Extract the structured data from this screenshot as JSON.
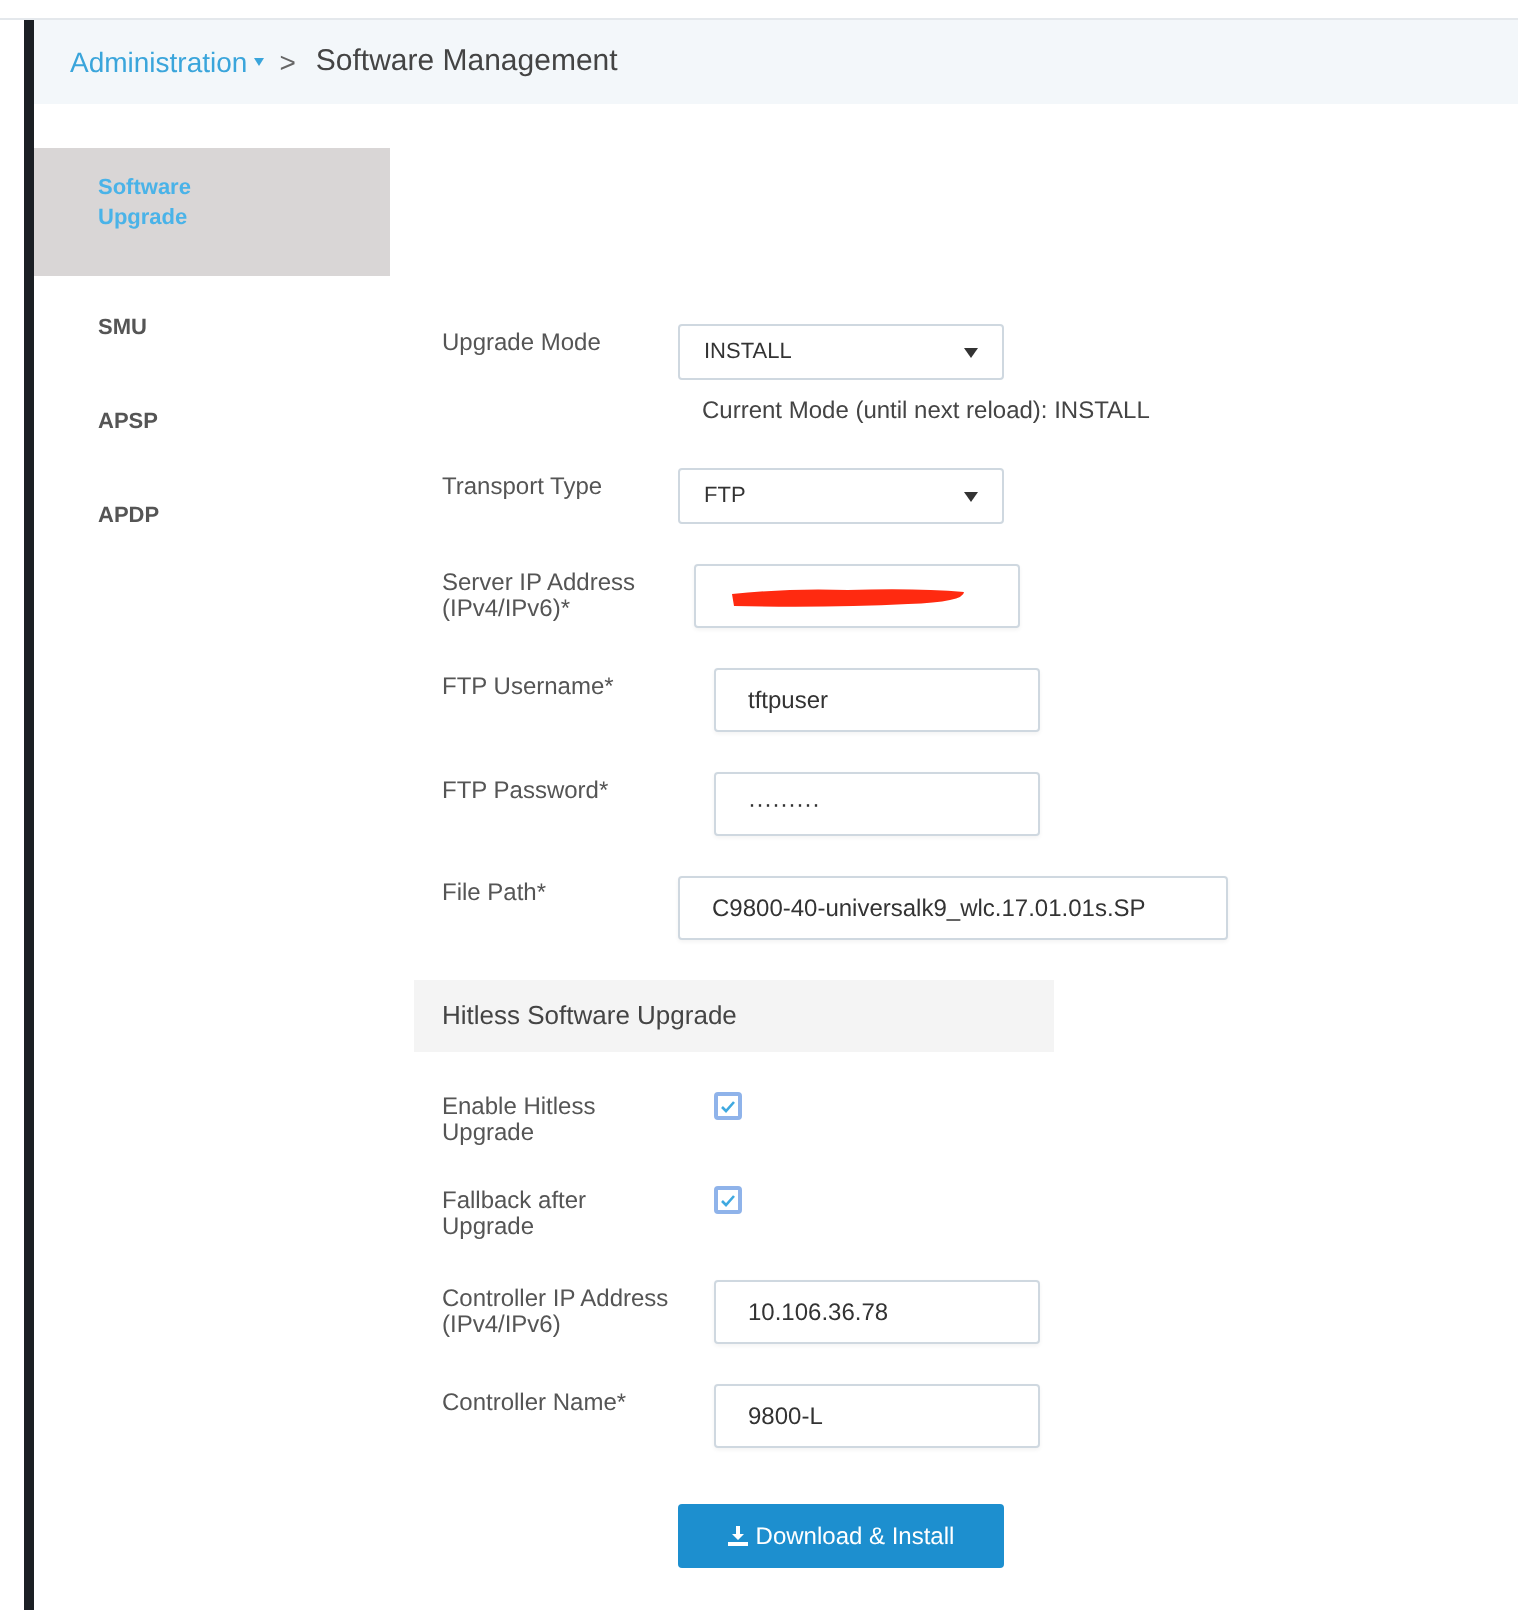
{
  "breadcrumb": {
    "parent": "Administration",
    "separator": ">",
    "current": "Software Management"
  },
  "sidebar": {
    "items": [
      {
        "label": "Software Upgrade",
        "selected": true
      },
      {
        "label": "SMU",
        "selected": false
      },
      {
        "label": "APSP",
        "selected": false
      },
      {
        "label": "APDP",
        "selected": false
      }
    ]
  },
  "form": {
    "fields": [
      {
        "kind": "select",
        "label": "Upgrade Mode",
        "value": "INSTALL",
        "hint": "Current Mode (until next reload): INSTALL"
      },
      {
        "kind": "select",
        "label": "Transport Type",
        "value": "FTP"
      },
      {
        "kind": "redacted",
        "label": "Server IP Address (IPv4/IPv6)*"
      },
      {
        "kind": "text",
        "label": "FTP Username*",
        "value": "tftpuser"
      },
      {
        "kind": "text",
        "label": "FTP Password*",
        "value": "·········"
      },
      {
        "kind": "wide",
        "label": "File Path*",
        "value": "C9800-40-universalk9_wlc.17.01.01s.SP"
      },
      {
        "kind": "section",
        "label": "Hitless Software Upgrade"
      },
      {
        "kind": "checkbox",
        "label": "Enable Hitless Upgrade",
        "checked": true
      },
      {
        "kind": "checkbox",
        "label": "Fallback after Upgrade",
        "checked": true
      },
      {
        "kind": "text",
        "label": "Controller IP Address (IPv4/IPv6)",
        "value": "10.106.36.78"
      },
      {
        "kind": "text",
        "label": "Controller Name*",
        "value": "9800-L"
      }
    ],
    "button": "Download & Install"
  }
}
